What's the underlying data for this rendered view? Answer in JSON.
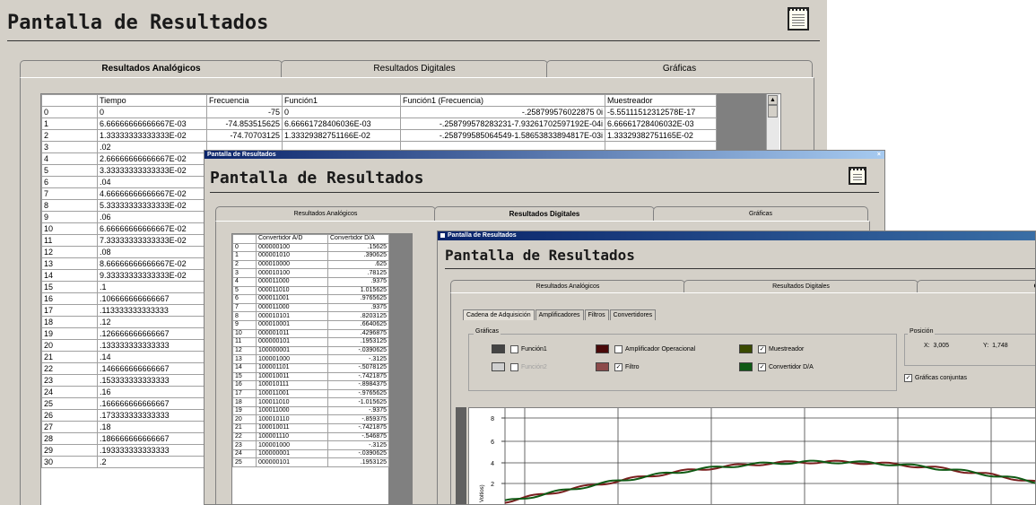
{
  "win1": {
    "header": "Pantalla de Resultados",
    "tabs": [
      "Resultados Analógicos",
      "Resultados Digitales",
      "Gráficas"
    ],
    "columns": [
      "Tiempo",
      "Frecuencia",
      "Función1",
      "Función1 (Frecuencia)",
      "Muestreador"
    ],
    "rows": [
      [
        "0",
        "0",
        "-75",
        "0",
        "-.258799576022875 0i",
        "-5.55111512312578E-17"
      ],
      [
        "1",
        "6.66666666666667E-03",
        "-74.853515625",
        "6.66661728406036E-03",
        "-.258799578283231-7.93261702597192E-04i",
        "6.66661728406032E-03"
      ],
      [
        "2",
        "1.33333333333333E-02",
        "-74.70703125",
        "1.33329382751166E-02",
        "-.258799585064549-1.58653833894817E-03i",
        "1.33329382751165E-02"
      ],
      [
        "3",
        ".02",
        "",
        "",
        "",
        ""
      ],
      [
        "4",
        "2.66666666666667E-02",
        "",
        "",
        "",
        ""
      ],
      [
        "5",
        "3.33333333333333E-02",
        "",
        "",
        "",
        ""
      ],
      [
        "6",
        ".04",
        "",
        "",
        "",
        ""
      ],
      [
        "7",
        "4.66666666666667E-02",
        "",
        "",
        "",
        ""
      ],
      [
        "8",
        "5.33333333333333E-02",
        "",
        "",
        "",
        ""
      ],
      [
        "9",
        ".06",
        "",
        "",
        "",
        ""
      ],
      [
        "10",
        "6.66666666666667E-02",
        "",
        "",
        "",
        ""
      ],
      [
        "11",
        "7.33333333333333E-02",
        "",
        "",
        "",
        ""
      ],
      [
        "12",
        ".08",
        "",
        "",
        "",
        ""
      ],
      [
        "13",
        "8.66666666666667E-02",
        "",
        "",
        "",
        ""
      ],
      [
        "14",
        "9.33333333333333E-02",
        "",
        "",
        "",
        ""
      ],
      [
        "15",
        ".1",
        "",
        "",
        "",
        ""
      ],
      [
        "16",
        ".106666666666667",
        "",
        "",
        "",
        ""
      ],
      [
        "17",
        ".113333333333333",
        "",
        "",
        "",
        ""
      ],
      [
        "18",
        ".12",
        "",
        "",
        "",
        ""
      ],
      [
        "19",
        ".126666666666667",
        "",
        "",
        "",
        ""
      ],
      [
        "20",
        ".133333333333333",
        "",
        "",
        "",
        ""
      ],
      [
        "21",
        ".14",
        "",
        "",
        "",
        ""
      ],
      [
        "22",
        ".146666666666667",
        "",
        "",
        "",
        ""
      ],
      [
        "23",
        ".153333333333333",
        "",
        "",
        "",
        ""
      ],
      [
        "24",
        ".16",
        "",
        "",
        "",
        ""
      ],
      [
        "25",
        ".166666666666667",
        "",
        "",
        "",
        ""
      ],
      [
        "26",
        ".173333333333333",
        "",
        "",
        "",
        ""
      ],
      [
        "27",
        ".18",
        "",
        "",
        "",
        ""
      ],
      [
        "28",
        ".186666666666667",
        "",
        "",
        "",
        ""
      ],
      [
        "29",
        ".193333333333333",
        "",
        "",
        "",
        ""
      ],
      [
        "30",
        ".2",
        "",
        "",
        "",
        ""
      ]
    ]
  },
  "win2": {
    "title": "Pantalla de Resultados",
    "header": "Pantalla de Resultados",
    "close_glyph": "×",
    "tabs": [
      "Resultados Analógicos",
      "Resultados Digitales",
      "Gráficas"
    ],
    "columns": [
      "Convertidor A/D",
      "Convertidor D/A"
    ],
    "rows": [
      [
        "0",
        "000000100",
        ".15625"
      ],
      [
        "1",
        "000001010",
        ".390625"
      ],
      [
        "2",
        "000010000",
        ".625"
      ],
      [
        "3",
        "000010100",
        ".78125"
      ],
      [
        "4",
        "000011000",
        ".9375"
      ],
      [
        "5",
        "000011010",
        "1.015625"
      ],
      [
        "6",
        "000011001",
        ".9765625"
      ],
      [
        "7",
        "000011000",
        ".9375"
      ],
      [
        "8",
        "000010101",
        ".8203125"
      ],
      [
        "9",
        "000010001",
        ".6640625"
      ],
      [
        "10",
        "000001011",
        ".4296875"
      ],
      [
        "11",
        "000000101",
        ".1953125"
      ],
      [
        "12",
        "100000001",
        "-.0390625"
      ],
      [
        "13",
        "100001000",
        "-.3125"
      ],
      [
        "14",
        "100001101",
        "-.5078125"
      ],
      [
        "15",
        "100010011",
        "-.7421875"
      ],
      [
        "16",
        "100010111",
        "-.8984375"
      ],
      [
        "17",
        "100011001",
        "-.9765625"
      ],
      [
        "18",
        "100011010",
        "-1.015625"
      ],
      [
        "19",
        "100011000",
        "-.9375"
      ],
      [
        "20",
        "100010110",
        "-.859375"
      ],
      [
        "21",
        "100010011",
        "-.7421875"
      ],
      [
        "22",
        "100001110",
        "-.546875"
      ],
      [
        "23",
        "100001000",
        "-.3125"
      ],
      [
        "24",
        "100000001",
        "-.0390625"
      ],
      [
        "25",
        "000000101",
        ".1953125"
      ]
    ]
  },
  "win3": {
    "title": "Pantalla de Resultados",
    "header": "Pantalla de Resultados",
    "tabs": [
      "Resultados Analógicos",
      "Resultados Digitales",
      "Gráf"
    ],
    "subtabs": [
      "Cadena de Adquisición",
      "Amplificadores",
      "Filtros",
      "Convertidores"
    ],
    "graficas_label": "Gráficas",
    "legend": [
      {
        "label": "Función1",
        "color": "#444444",
        "checked": false,
        "enabled": true
      },
      {
        "label": "Amplificador Operacional",
        "color": "#4a0a0a",
        "checked": false,
        "enabled": true
      },
      {
        "label": "Muestreador",
        "color": "#3a4a00",
        "checked": true,
        "enabled": true
      },
      {
        "label": "Función2",
        "color": "#cfcfcf",
        "checked": false,
        "enabled": false
      },
      {
        "label": "Filtro",
        "color": "#8c4a4a",
        "checked": true,
        "enabled": true
      },
      {
        "label": "Convertidor D/A",
        "color": "#0f5a14",
        "checked": true,
        "enabled": true
      }
    ],
    "check_mark": "✓",
    "posicion_label": "Posición",
    "x_label": "X:",
    "x_value": "3,005",
    "y_label": "Y:",
    "y_value": "1,748",
    "conjuntas_label": "Gráficas conjuntas",
    "conjuntas_checked": true,
    "chart_data": {
      "type": "line",
      "yticks": [
        "8",
        "6",
        "4",
        "2"
      ],
      "ylabel_fragment": "Voltios)",
      "series": [
        {
          "color": "#7a1e1e"
        },
        {
          "color": "#0f5a14"
        }
      ]
    }
  }
}
